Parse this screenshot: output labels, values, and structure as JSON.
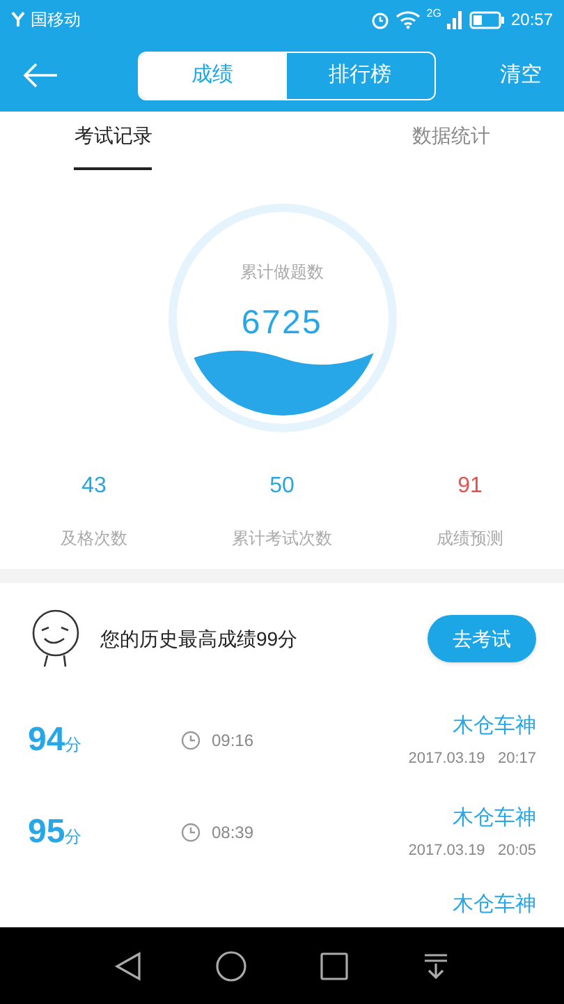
{
  "status_bar": {
    "carrier": "国移动",
    "network": "2G",
    "time": "20:57"
  },
  "header": {
    "segments": [
      {
        "label": "成绩",
        "selected": true
      },
      {
        "label": "排行榜",
        "selected": false
      }
    ],
    "action": "清空"
  },
  "tabs": [
    {
      "label": "考试记录",
      "selected": true
    },
    {
      "label": "数据统计",
      "selected": false
    }
  ],
  "gauge": {
    "label": "累计做题数",
    "value": "6725"
  },
  "stats": [
    {
      "value": "43",
      "label": "及格次数",
      "color": "#2fa3dc"
    },
    {
      "value": "50",
      "label": "累计考试次数",
      "color": "#2fa3dc"
    },
    {
      "value": "91",
      "label": "成绩预测",
      "color": "#e0514f"
    }
  ],
  "best": {
    "text": "您的历史最高成绩99分",
    "button": "去考试"
  },
  "records": [
    {
      "score": "94",
      "unit": "分",
      "duration": "09:16",
      "name": "木仓车神",
      "date": "2017.03.19   20:17"
    },
    {
      "score": "95",
      "unit": "分",
      "duration": "08:39",
      "name": "木仓车神",
      "date": "2017.03.19   20:05"
    },
    {
      "name": "木仓车神"
    }
  ]
}
